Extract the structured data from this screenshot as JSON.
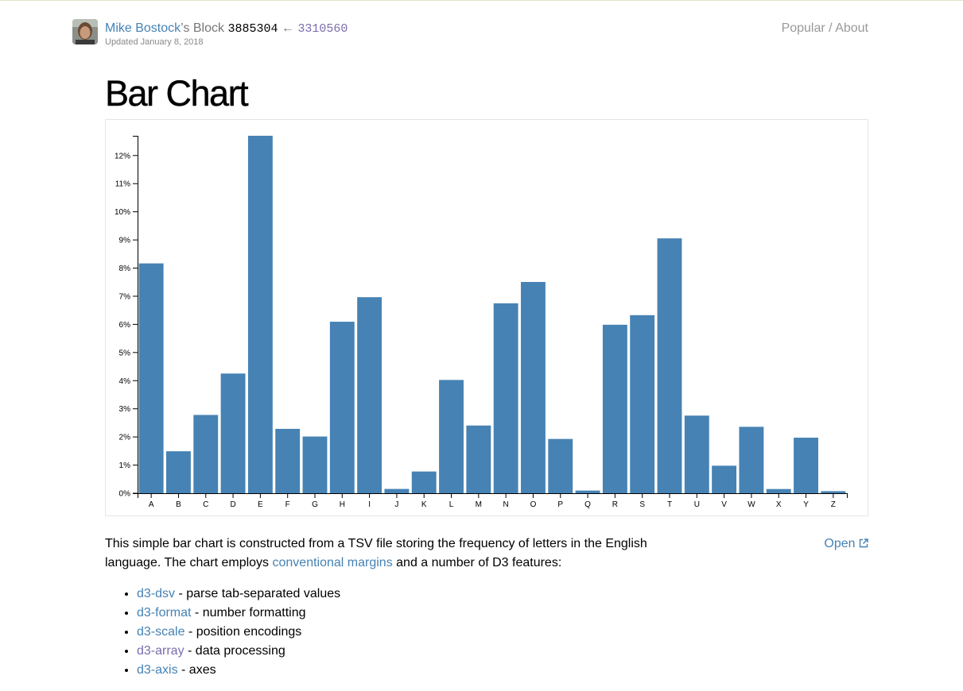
{
  "header": {
    "author": "Mike Bostock",
    "possessive": "’s Block",
    "block_id": "3885304",
    "arrow": "←",
    "parent_id": "3310560",
    "updated": "Updated January 8, 2018"
  },
  "nav": {
    "popular": "Popular",
    "separator": "/",
    "about": "About"
  },
  "title": "Bar Chart",
  "description": {
    "part1": "This simple bar chart is constructed from a TSV file storing the frequency of letters in the English language. The chart employs ",
    "link": "conventional margins",
    "part2": " and a number of D3 features:"
  },
  "open": {
    "label": "Open",
    "icon": "external-link-icon"
  },
  "features": [
    {
      "link": "d3-dsv",
      "text": " - parse tab-separated values",
      "visited": false
    },
    {
      "link": "d3-format",
      "text": " - number formatting",
      "visited": false
    },
    {
      "link": "d3-scale",
      "text": " - position encodings",
      "visited": false
    },
    {
      "link": "d3-array",
      "text": " - data processing",
      "visited": true
    },
    {
      "link": "d3-axis",
      "text": " - axes",
      "visited": false
    }
  ],
  "colors": {
    "bar": "#4682b4",
    "link": "#4682b4",
    "visited": "#7b6dad"
  },
  "chart_data": {
    "type": "bar",
    "categories": [
      "A",
      "B",
      "C",
      "D",
      "E",
      "F",
      "G",
      "H",
      "I",
      "J",
      "K",
      "L",
      "M",
      "N",
      "O",
      "P",
      "Q",
      "R",
      "S",
      "T",
      "U",
      "V",
      "W",
      "X",
      "Y",
      "Z"
    ],
    "values": [
      0.08167,
      0.01492,
      0.02782,
      0.04253,
      0.12702,
      0.02288,
      0.02015,
      0.06094,
      0.06966,
      0.00153,
      0.00772,
      0.04025,
      0.02406,
      0.06749,
      0.07507,
      0.01929,
      0.00095,
      0.05987,
      0.06327,
      0.09056,
      0.02758,
      0.00978,
      0.0236,
      0.0015,
      0.01974,
      0.00074
    ],
    "ylim": [
      0,
      0.127
    ],
    "yticks": [
      "0%",
      "1%",
      "2%",
      "3%",
      "4%",
      "5%",
      "6%",
      "7%",
      "8%",
      "9%",
      "10%",
      "11%",
      "12%"
    ],
    "title": "",
    "xlabel": "",
    "ylabel": "",
    "grid": false,
    "legend": "none"
  }
}
